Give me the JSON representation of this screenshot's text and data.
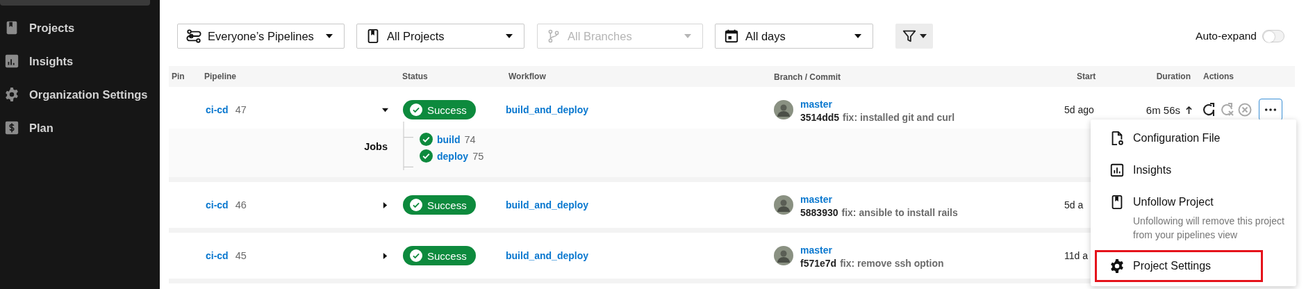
{
  "sidebar": {
    "items": [
      {
        "label": "Projects",
        "kind": "book"
      },
      {
        "label": "Insights",
        "kind": "chart"
      },
      {
        "label": "Organization Settings",
        "kind": "gear"
      },
      {
        "label": "Plan",
        "kind": "dollar"
      }
    ]
  },
  "filters": [
    {
      "label": "Everyone’s Pipelines",
      "kind": "pipelines",
      "disabled": false
    },
    {
      "label": "All Projects",
      "kind": "book",
      "disabled": false
    },
    {
      "label": "All Branches",
      "kind": "branch",
      "disabled": true
    },
    {
      "label": "All days",
      "kind": "calendar",
      "disabled": false
    }
  ],
  "auto_expand": {
    "label": "Auto-expand",
    "on": false
  },
  "table": {
    "columns": [
      "Pin",
      "Pipeline",
      "Status",
      "Workflow",
      "Branch / Commit",
      "Start",
      "Duration",
      "Actions"
    ],
    "rows": [
      {
        "project": "ci-cd",
        "number": "47",
        "expanded": true,
        "status": "Success",
        "workflow": "build_and_deploy",
        "branch": "master",
        "commit_hash": "3514dd5",
        "commit_message": "fix: installed git and curl",
        "start": "5d ago",
        "duration": "6m 56s",
        "jobs_label": "Jobs",
        "jobs": [
          {
            "name": "build",
            "number": "74"
          },
          {
            "name": "deploy",
            "number": "75"
          }
        ]
      },
      {
        "project": "ci-cd",
        "number": "46",
        "expanded": false,
        "status": "Success",
        "workflow": "build_and_deploy",
        "branch": "master",
        "commit_hash": "5883930",
        "commit_message": "fix: ansible to install rails",
        "start": "5d a"
      },
      {
        "project": "ci-cd",
        "number": "45",
        "expanded": false,
        "status": "Success",
        "workflow": "build_and_deploy",
        "branch": "master",
        "commit_hash": "f571e7d",
        "commit_message": "fix: remove ssh option",
        "start": "11d a"
      }
    ]
  },
  "actions_menu": {
    "items": [
      {
        "label": "Configuration File",
        "kind": "file",
        "highlighted": false
      },
      {
        "label": "Insights",
        "kind": "chart",
        "highlighted": false
      },
      {
        "label": "Unfollow Project",
        "kind": "book",
        "description": "Unfollowing will remove this project from your pipelines view",
        "highlighted": false
      },
      {
        "label": "Project Settings",
        "kind": "gear",
        "highlighted": true
      }
    ]
  }
}
